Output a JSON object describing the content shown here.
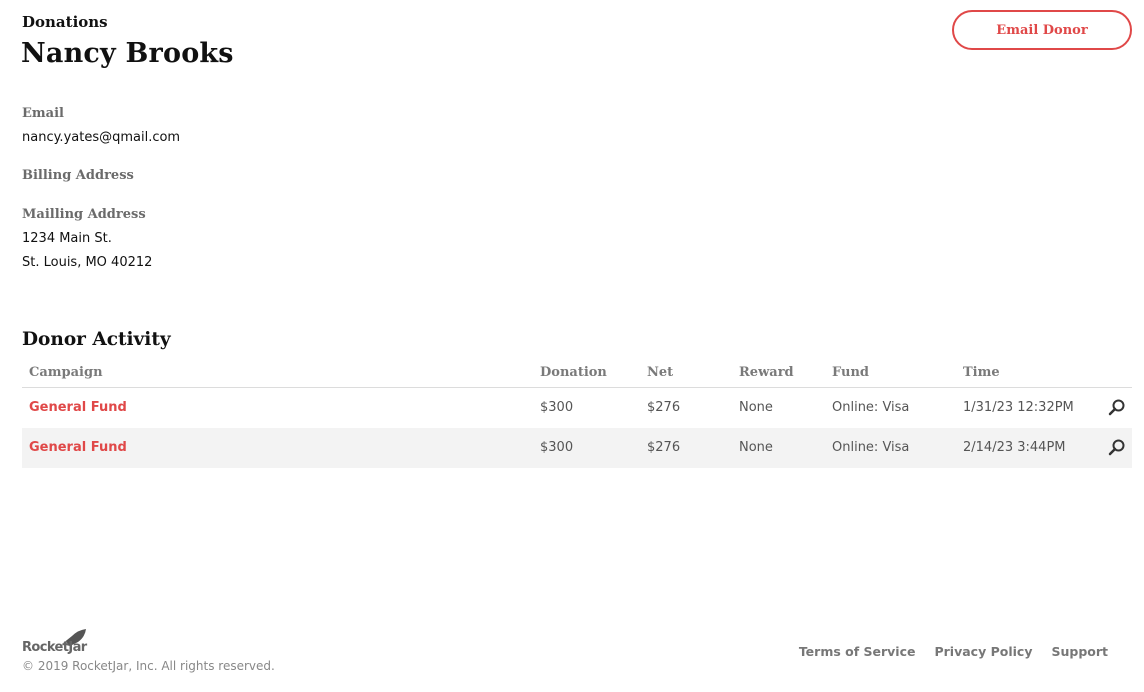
{
  "header": {
    "breadcrumb": "Donations",
    "title": "Nancy Brooks",
    "email_button": "Email Donor"
  },
  "details": {
    "email_label": "Email",
    "email_value": "nancy.yates@qmail.com",
    "billing_label": "Billing Address",
    "mailing_label": "Mailling Address",
    "mailing_line1": "1234 Main St.",
    "mailing_line2": "St. Louis, MO 40212"
  },
  "activity": {
    "title": "Donor Activity",
    "columns": [
      "Campaign",
      "Donation",
      "Net",
      "Reward",
      "Fund",
      "Time"
    ],
    "rows": [
      {
        "campaign": "General Fund",
        "donation": "$300",
        "net": "$276",
        "reward": "None",
        "fund": "Online: Visa",
        "time": "1/31/23 12:32PM"
      },
      {
        "campaign": "General Fund",
        "donation": "$300",
        "net": "$276",
        "reward": "None",
        "fund": "Online: Visa",
        "time": "2/14/23 3:44PM"
      }
    ]
  },
  "footer": {
    "logo_text": "RocketJar",
    "copyright": "© 2019 RocketJar, Inc. All rights reserved.",
    "links": [
      "Terms of Service",
      "Privacy Policy",
      "Support"
    ]
  },
  "colors": {
    "accent": "#e04848",
    "label_gray": "#6b6b6b",
    "row_alt": "#f3f3f3"
  },
  "icons": {
    "row_action": "search-icon",
    "logo": "rocket-icon"
  }
}
